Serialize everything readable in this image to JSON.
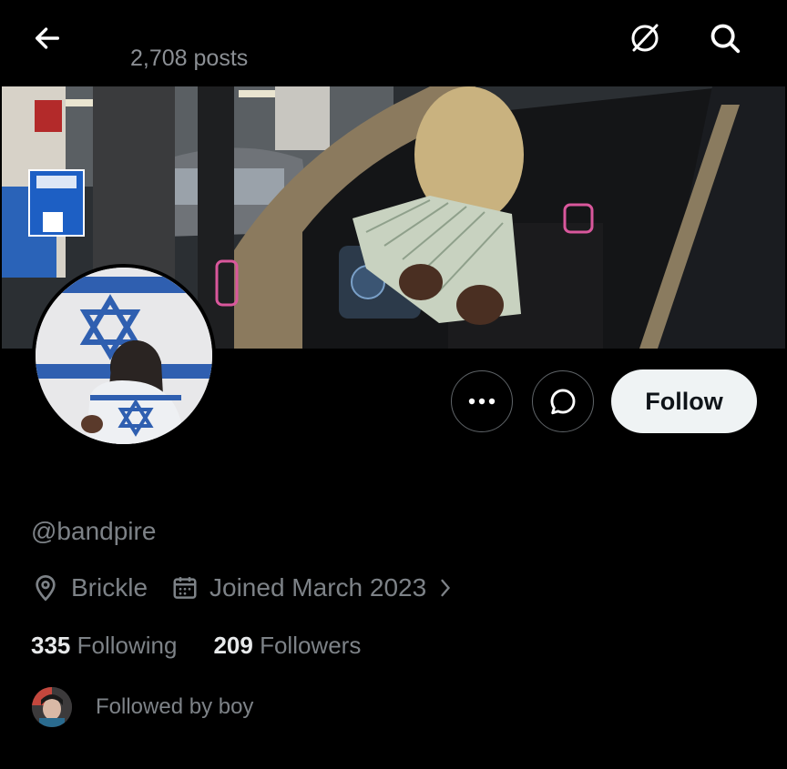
{
  "header": {
    "posts_count": "2,708 posts",
    "icons": {
      "back": "back-arrow-icon",
      "grok": "grok-icon",
      "search": "search-icon"
    }
  },
  "profile": {
    "handle": "@bandpire",
    "location": "Brickle",
    "joined": "Joined March 2023",
    "following_count": "335",
    "following_label": "Following",
    "followers_count": "209",
    "followers_label": "Followers",
    "followed_by": "Followed by boy"
  },
  "actions": {
    "follow_label": "Follow",
    "more_icon": "more-icon",
    "message_icon": "chat-bubble-icon"
  },
  "colors": {
    "background": "#000000",
    "primary_text": "#e7e9ea",
    "secondary_text": "#7d8287",
    "follow_button_bg": "#eff3f4",
    "follow_button_text": "#0f1419"
  }
}
